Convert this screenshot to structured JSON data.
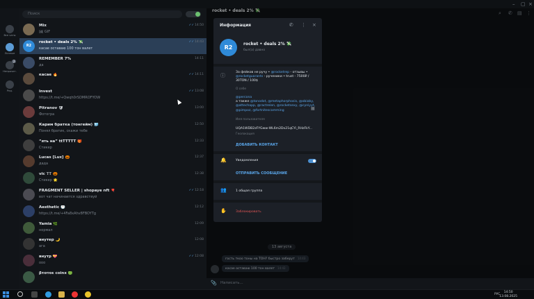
{
  "window": {
    "title": "rocket • deals 2% 💸"
  },
  "rail": [
    {
      "label": "Все чаты",
      "icon": "chats-icon",
      "badge": ""
    },
    {
      "label": "Личные",
      "icon": "person-icon",
      "badge": ""
    },
    {
      "label": "Непрочит.",
      "icon": "unread-icon",
      "badge": "2"
    },
    {
      "label": "Ред.",
      "icon": "edit-icon",
      "badge": ""
    }
  ],
  "search": {
    "placeholder": "Поиск"
  },
  "chats": [
    {
      "name": "Mix",
      "preview": "🖼 GIF",
      "time": "14:50",
      "check": "✓✓"
    },
    {
      "name": "rocket • deals 2% 💸",
      "preview": "касае оставаю 100 тон валет",
      "time": "14:43",
      "check": "✓✓",
      "avatar": "R2"
    },
    {
      "name": "REMEMBER 7%",
      "preview": "да",
      "time": "14:11",
      "check": ""
    },
    {
      "name": "касае 🔥",
      "preview": "",
      "time": "14:11",
      "check": "✓✓"
    },
    {
      "name": "lnvest",
      "preview": "https://t.me/+Qwqh0rSDMROFYOW",
      "time": "13:08",
      "check": "✓✓"
    },
    {
      "name": "Pitranov 🛡",
      "preview": "Фотогра",
      "time": "13:00",
      "check": ""
    },
    {
      "name": "Карим братка (тонгейм) 🧊",
      "preview": "Понял братик, скажи тебе",
      "time": "12:50",
      "check": ""
    },
    {
      "name": "“ять на” ttTTTTT 🎁",
      "preview": "Стикер",
      "time": "12:33",
      "check": ""
    },
    {
      "name": "Lucas [Lux] 🎃",
      "preview": "дада",
      "time": "12:37",
      "check": ""
    },
    {
      "name": "vic 𝕋𝕋 🎃",
      "preview": "Стикер 🌟",
      "time": "12:38",
      "check": ""
    },
    {
      "name": "FRAGMENT SELLER | shopaye nft 🎈",
      "preview": "вот чат начинается здравствуй",
      "time": "12:18",
      "check": "✓✓"
    },
    {
      "name": "Aesthetic 🕐",
      "preview": "https://t.me/+4Fa8xAhv8FBOYTg",
      "time": "12:12",
      "check": ""
    },
    {
      "name": "Yamia 🌿",
      "preview": "нормал",
      "time": "12:09",
      "check": ""
    },
    {
      "name": "внутер 🌙",
      "preview": "ага",
      "time": "12:08",
      "check": ""
    },
    {
      "name": "внутр 💝",
      "preview": "ооо",
      "time": "12:08",
      "check": "✓✓"
    },
    {
      "name": "βτοτοε coinx 🟢",
      "preview": "",
      "time": "",
      "check": ""
    }
  ],
  "panel": {
    "title": "Информация",
    "avatar": "R2",
    "name": "rocket • deals 2% 💸",
    "status": "был(а) давно",
    "bio_prefix": "За фейков не ручу • ",
    "bio_link1": "@rocketrep",
    "bio_mid": " - отзывы • ",
    "bio_link2": "@rocketguarants",
    "bio_suffix": " - рученики • trust - 7500₽ / 30TON / 100$",
    "bio_label": "О себе",
    "username": "@percona",
    "usernames_prefix": "а также ",
    "usernames": "@tonodot, @metaphorphosis, @obioby, @attechapp, @ractrelen, @rocketsexy, @cyniyyt, @pimpoz, @fortnitescamming",
    "usernames_label": "Имя пользователя",
    "wallet": "UQA1WDB2zFYGww-WL6m2Dx21qCYi_RHzFkY...",
    "wallet_label": "Геолокация",
    "add_contact": "ДОБАВИТЬ КОНТАКТ",
    "notifications": "Уведомления",
    "notifications_on": true,
    "send_message": "ОТПРАВИТЬ СООБЩЕНИЕ",
    "groups": "1 общая группа",
    "block": "Заблокировать"
  },
  "conversation": {
    "date": "13 августа",
    "messages": [
      {
        "text": "гость ткоо тоны на ТОН? быстро заберут",
        "time": "14:43"
      },
      {
        "text": "касае оставаю 100 тон валет",
        "time": "14:43"
      }
    ],
    "composer_placeholder": "Написать..."
  },
  "taskbar": {
    "lang": "РУС",
    "time": "14:50",
    "date": "13.08.2025"
  },
  "colors": {
    "accent": "#5aa6ea",
    "selected": "#2b3f57",
    "danger": "#e05555",
    "avatar": "#2f8ad8"
  }
}
